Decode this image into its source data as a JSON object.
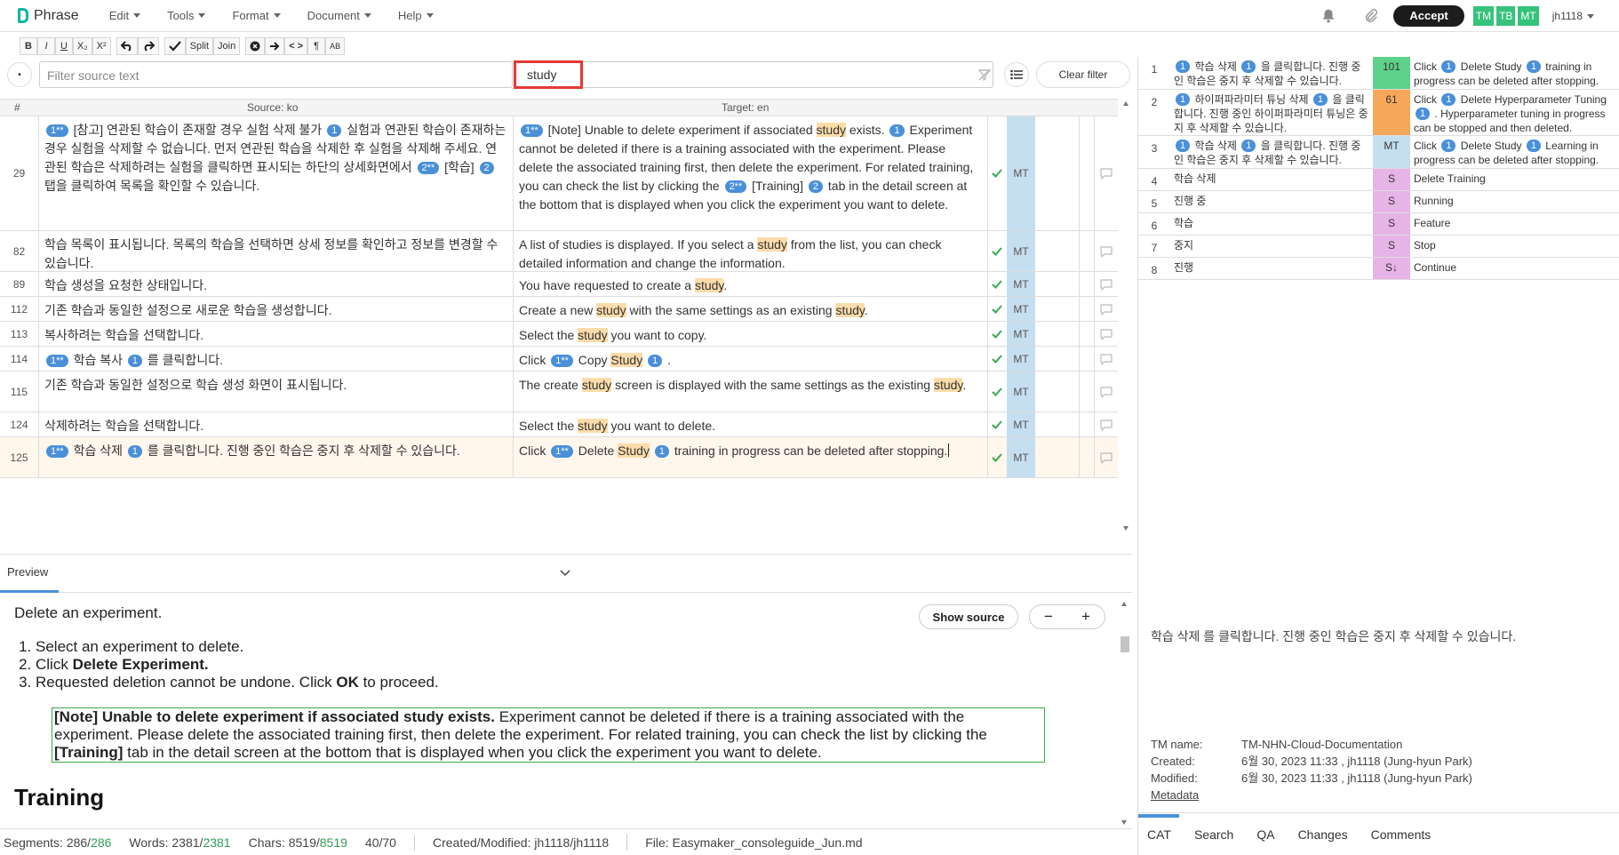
{
  "app": {
    "name": "Phrase"
  },
  "menu": {
    "edit": "Edit",
    "tools": "Tools",
    "format": "Format",
    "document": "Document",
    "help": "Help"
  },
  "header_right": {
    "accept": "Accept",
    "tm": "TM",
    "tb": "TB",
    "mt": "MT",
    "user": "jh1118"
  },
  "toolbar": {
    "bold": "B",
    "italic": "I",
    "underline": "U",
    "sub": "X₂",
    "sup": "X²",
    "split": "Split",
    "join": "Join",
    "tags": "< >",
    "pilcrow": "¶",
    "case": "AB"
  },
  "filter": {
    "source_placeholder": "Filter source text",
    "target_value": "study",
    "clear": "Clear filter"
  },
  "grid": {
    "col_num": "#",
    "col_source": "Source: ko",
    "col_target": "Target: en"
  },
  "segments": [
    {
      "num": "29",
      "status": "MT",
      "src": [
        {
          "tag": "1**"
        },
        {
          "t": " [참고] 연관된 학습이 존재할 경우 실험 삭제 불가 "
        },
        {
          "tag": "1"
        },
        {
          "t": " 실험과 연관된 학습이 존재하는 경우 실험을 삭제할 수 없습니다. 먼저 연관된 학습을 삭제한 후 실험을 삭제해 주세요. 연관된 학습은 삭제하려는 실험을 클릭하면 표시되는 하단의 상세화면에서 "
        },
        {
          "tag": "2**"
        },
        {
          "t": " [학습] "
        },
        {
          "tag": "2"
        },
        {
          "t": " 탭을 클릭하여 목록을 확인할 수 있습니다."
        }
      ],
      "tgt": [
        {
          "tag": "1**"
        },
        {
          "t": " [Note] Unable to delete experiment if associated "
        },
        {
          "hl": "study"
        },
        {
          "t": " exists. "
        },
        {
          "tag": "1"
        },
        {
          "t": " Experiment cannot be deleted if there is a training associated with the experiment. Please delete the associated training first, then delete the experiment. For related training, you can check the list by clicking the "
        },
        {
          "tag": "2**"
        },
        {
          "t": " [Training] "
        },
        {
          "tag": "2"
        },
        {
          "t": " tab in the detail screen at the bottom that is displayed when you click the experiment you want to delete."
        }
      ]
    },
    {
      "num": "82",
      "status": "MT",
      "src": [
        {
          "t": "학습 목록이 표시됩니다. 목록의 학습을 선택하면 상세 정보를 확인하고 정보를 변경할 수 있습니다."
        }
      ],
      "tgt": [
        {
          "t": "A list of studies is displayed. If you select a "
        },
        {
          "hl": "study"
        },
        {
          "t": " from the list, you can check detailed information and change the information."
        }
      ]
    },
    {
      "num": "89",
      "status": "MT",
      "src": [
        {
          "t": "학습 생성을 요청한 상태입니다."
        }
      ],
      "tgt": [
        {
          "t": "You have requested to create a "
        },
        {
          "hl": "study"
        },
        {
          "t": "."
        }
      ]
    },
    {
      "num": "112",
      "status": "MT",
      "src": [
        {
          "t": "기존 학습과 동일한 설정으로 새로운 학습을 생성합니다."
        }
      ],
      "tgt": [
        {
          "t": "Create a new "
        },
        {
          "hl": "study"
        },
        {
          "t": " with the same settings as an existing "
        },
        {
          "hl": "study"
        },
        {
          "t": "."
        }
      ]
    },
    {
      "num": "113",
      "status": "MT",
      "src": [
        {
          "t": "복사하려는 학습을 선택합니다."
        }
      ],
      "tgt": [
        {
          "t": "Select the "
        },
        {
          "hl": "study"
        },
        {
          "t": " you want to copy."
        }
      ]
    },
    {
      "num": "114",
      "status": "MT",
      "src": [
        {
          "tag": "1**"
        },
        {
          "t": " 학습 복사 "
        },
        {
          "tag": "1"
        },
        {
          "t": " 를 클릭합니다."
        }
      ],
      "tgt": [
        {
          "t": "Click "
        },
        {
          "tag": "1**"
        },
        {
          "t": " Copy "
        },
        {
          "hl": "Study"
        },
        {
          "t": " "
        },
        {
          "tag": "1"
        },
        {
          "t": " ."
        }
      ]
    },
    {
      "num": "115",
      "status": "MT",
      "src": [
        {
          "t": "기존 학습과 동일한 설정으로 학습 생성 화면이 표시됩니다."
        }
      ],
      "tgt": [
        {
          "t": "The create "
        },
        {
          "hl": "study"
        },
        {
          "t": " screen is displayed with the same settings as the existing "
        },
        {
          "hl": "study"
        },
        {
          "t": "."
        }
      ]
    },
    {
      "num": "124",
      "status": "MT",
      "src": [
        {
          "t": "삭제하려는 학습을 선택합니다."
        }
      ],
      "tgt": [
        {
          "t": "Select the "
        },
        {
          "hl": "study"
        },
        {
          "t": " you want to delete."
        }
      ]
    },
    {
      "num": "125",
      "status": "MT",
      "src": [
        {
          "tag": "1**"
        },
        {
          "t": " 학습 삭제 "
        },
        {
          "tag": "1"
        },
        {
          "t": " 를 클릭합니다. 진행 중인 학습은 중지 후 삭제할 수 있습니다."
        }
      ],
      "tgt": [
        {
          "t": "Click "
        },
        {
          "tag": "1**"
        },
        {
          "t": " Delete "
        },
        {
          "hl": "Study"
        },
        {
          "t": " "
        },
        {
          "tag": "1"
        },
        {
          "t": " training in progress can be deleted after stopping."
        }
      ]
    }
  ],
  "preview": {
    "tab": "Preview",
    "show_source": "Show source",
    "zoom_minus": "−",
    "zoom_plus": "+",
    "lead": "Delete an experiment.",
    "list": [
      [
        {
          "t": "Select an experiment to delete."
        }
      ],
      [
        {
          "t": "Click "
        },
        {
          "b": "Delete Experiment."
        }
      ],
      [
        {
          "t": "Requested deletion cannot be undone. Click "
        },
        {
          "b": "OK"
        },
        {
          "t": " to proceed."
        }
      ]
    ],
    "box": [
      {
        "b": "[Note] Unable to delete experiment if associated study exists."
      },
      {
        "t": " Experiment cannot be deleted if there is a training associated with the experiment. Please delete the associated training first, then delete the experiment. For related training, you can check the list by clicking the "
      },
      {
        "b": "[Training]"
      },
      {
        "t": " tab in the detail screen at the bottom that is displayed when you click the experiment you want to delete."
      }
    ],
    "heading": "Training"
  },
  "status_bar": {
    "segments_label": "Segments: 286/",
    "segments_total": "286",
    "words_label": "Words: 2381/",
    "words_total": "2381",
    "chars_label": "Chars: 8519/",
    "chars_total": "8519",
    "progress": "40/70",
    "created": "Created/Modified: jh1118/jh1118",
    "file": "File: Easymaker_consoleguide_Jun.md"
  },
  "cat": [
    {
      "num": "1",
      "score": "101",
      "color": "#5ed18a",
      "src": [
        {
          "tag": "1"
        },
        {
          "t": " 학습 삭제 "
        },
        {
          "tag": "1"
        },
        {
          "t": " 을 클릭합니다. 진행 중인 학습은 중지 후 삭제할 수 있습니다."
        }
      ],
      "tgt": [
        {
          "t": "Click "
        },
        {
          "tag": "1"
        },
        {
          "t": " Delete Study "
        },
        {
          "tag": "1"
        },
        {
          "t": " training in progress can be deleted after stopping."
        }
      ]
    },
    {
      "num": "2",
      "score": "61",
      "color": "#f6a85a",
      "src": [
        {
          "tag": "1"
        },
        {
          "t": " 하이퍼파라미터 튜닝 삭제 "
        },
        {
          "tag": "1"
        },
        {
          "t": " 을 클릭합니다. 진행 중인 하이퍼파라미터 튜닝은 중지 후 삭제할 수 있습니다."
        }
      ],
      "tgt": [
        {
          "t": "Click "
        },
        {
          "tag": "1"
        },
        {
          "t": " Delete Hyperparameter Tuning "
        },
        {
          "tag": "1"
        },
        {
          "t": " . Hyperparameter tuning in progress can be stopped and then deleted."
        }
      ]
    },
    {
      "num": "3",
      "score": "MT",
      "color": "#c6dff0",
      "src": [
        {
          "tag": "1"
        },
        {
          "t": " 학습 삭제 "
        },
        {
          "tag": "1"
        },
        {
          "t": " 을 클릭합니다. 진행 중인 학습은 중지 후 삭제할 수 있습니다."
        }
      ],
      "tgt": [
        {
          "t": "Click "
        },
        {
          "tag": "1"
        },
        {
          "t": " Delete Study "
        },
        {
          "tag": "1"
        },
        {
          "t": " Learning in progress can be deleted after stopping."
        }
      ]
    },
    {
      "num": "4",
      "score": "S",
      "color": "#e6b4e6",
      "src": [
        {
          "t": "학습 삭제"
        }
      ],
      "tgt": [
        {
          "t": "Delete Training"
        }
      ]
    },
    {
      "num": "5",
      "score": "S",
      "color": "#e6b4e6",
      "src": [
        {
          "t": "진행 중"
        }
      ],
      "tgt": [
        {
          "t": "Running"
        }
      ]
    },
    {
      "num": "6",
      "score": "S",
      "color": "#e6b4e6",
      "src": [
        {
          "t": "학습"
        }
      ],
      "tgt": [
        {
          "t": "Feature"
        }
      ]
    },
    {
      "num": "7",
      "score": "S",
      "color": "#e6b4e6",
      "src": [
        {
          "t": "중지"
        }
      ],
      "tgt": [
        {
          "t": "Stop"
        }
      ]
    },
    {
      "num": "8",
      "score": "S↓",
      "color": "#e6b4e6",
      "src": [
        {
          "t": "진행"
        }
      ],
      "tgt": [
        {
          "t": "Continue"
        }
      ]
    }
  ],
  "rpanel": {
    "current_source": "학습 삭제 를 클릭합니다. 진행 중인 학습은 중지 후 삭제할 수 있습니다.",
    "meta": {
      "tm_name_label": "TM name:",
      "tm_name": "TM-NHN-Cloud-Documentation",
      "created_label": "Created:",
      "created": "6월 30, 2023 11:33 , jh1118 (Jung-hyun Park)",
      "modified_label": "Modified:",
      "modified": "6월 30, 2023 11:33 , jh1118 (Jung-hyun Park)",
      "metadata_link": "Metadata"
    },
    "tabs": {
      "cat": "CAT",
      "search": "Search",
      "qa": "QA",
      "changes": "Changes",
      "comments": "Comments"
    }
  }
}
